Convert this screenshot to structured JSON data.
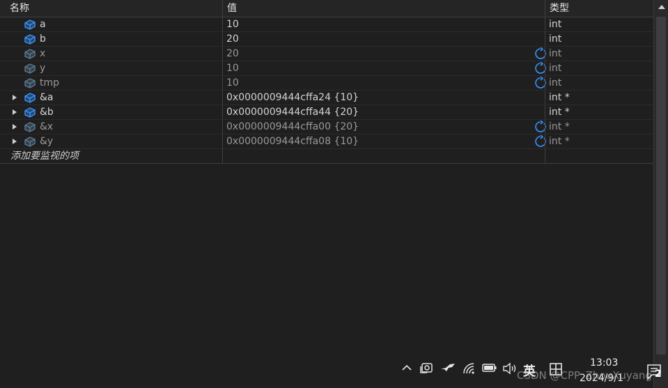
{
  "columns": {
    "name": "名称",
    "value": "值",
    "type": "类型"
  },
  "rows": [
    {
      "name": "a",
      "value": "10",
      "type": "int",
      "expandable": false,
      "stale": false
    },
    {
      "name": "b",
      "value": "20",
      "type": "int",
      "expandable": false,
      "stale": false
    },
    {
      "name": "x",
      "value": "20",
      "type": "int",
      "expandable": false,
      "stale": true
    },
    {
      "name": "y",
      "value": "10",
      "type": "int",
      "expandable": false,
      "stale": true
    },
    {
      "name": "tmp",
      "value": "10",
      "type": "int",
      "expandable": false,
      "stale": true
    },
    {
      "name": "&a",
      "value": "0x0000009444cffa24 {10}",
      "type": "int *",
      "expandable": true,
      "stale": false
    },
    {
      "name": "&b",
      "value": "0x0000009444cffa44 {20}",
      "type": "int *",
      "expandable": true,
      "stale": false
    },
    {
      "name": "&x",
      "value": "0x0000009444cffa00 {20}",
      "type": "int *",
      "expandable": true,
      "stale": true
    },
    {
      "name": "&y",
      "value": "0x0000009444cffa08 {10}",
      "type": "int *",
      "expandable": true,
      "stale": true
    }
  ],
  "add_item_placeholder": "添加要监视的项",
  "icons": {
    "variable": "variable-cube-icon",
    "refresh": "refresh-icon",
    "expander": "expand-arrow-icon"
  },
  "colors": {
    "accent": "#3794ff",
    "background": "#1f1f1f",
    "stale_text": "#9a9a9a"
  },
  "taskbar": {
    "ime_mode": "英",
    "time": "13:03",
    "date": "2024/9/1",
    "notification_count": "2",
    "watermark": "CSDN @CPP_ZhouXuyang"
  }
}
